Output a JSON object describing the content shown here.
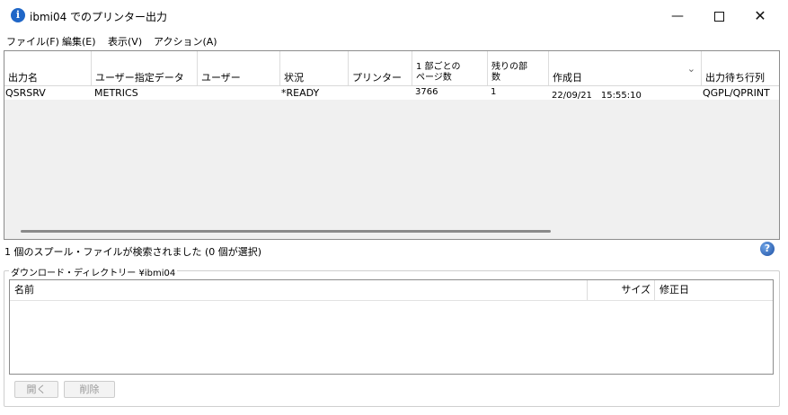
{
  "window": {
    "title": "ibmi04 でのプリンター出力",
    "app_icon_glyph": "i",
    "controls": {
      "minimize": "—",
      "close": "✕"
    }
  },
  "menu": [
    "ファイル(F)",
    "編集(E)",
    "表示(V)",
    "アクション(A)"
  ],
  "spool_table": {
    "columns": [
      "出力名",
      "ユーザー指定データ",
      "ユーザー",
      "状況",
      "プリンター",
      "1 部ごとの\nページ数",
      "残りの部\n数",
      "作成日",
      "出力待ち行列"
    ],
    "sort_indicator": "⌄",
    "rows": [
      {
        "output_name": "QSRSRV",
        "user_data": "METRICS",
        "user": "",
        "status": "*READY",
        "printer": "",
        "pages_per_copy": "3766",
        "copies_left": "1",
        "created": "22/09/21　15:55:10",
        "output_queue": "QGPL/QPRINT"
      }
    ]
  },
  "status": {
    "text": "1 個のスプール・ファイルが検索されました (0 個が選択)",
    "help_glyph": "?"
  },
  "download": {
    "legend": "ダウンロード・ディレクトリー ¥ibmi04",
    "columns": {
      "name": "名前",
      "size": "サイズ",
      "modified": "修正日"
    },
    "buttons": {
      "open": "開く",
      "delete": "削除"
    }
  },
  "colors": {
    "accent": "#1f66c7",
    "list_background": "#f0f0f0",
    "disabled_text": "#9a9a9a"
  }
}
